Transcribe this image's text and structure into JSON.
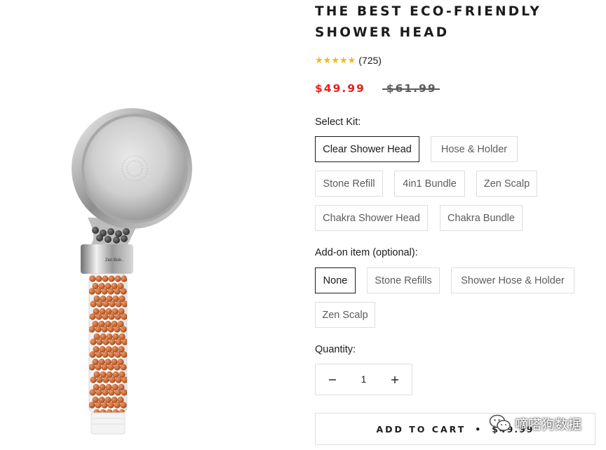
{
  "product": {
    "title_line1": "THE BEST ECO-FRIENDLY",
    "title_line2": "SHOWER HEAD",
    "rating_stars": 5,
    "rating_count": "(725)",
    "price_sale": "$49.99",
    "price_compare": "$61.99",
    "image_icon": "shower-head-photo"
  },
  "kit": {
    "label": "Select Kit:",
    "options": [
      "Clear Shower Head",
      "Hose & Holder",
      "Stone Refill",
      "4in1 Bundle",
      "Zen Scalp",
      "Chakra Shower Head",
      "Chakra Bundle"
    ],
    "selected": "Clear Shower Head"
  },
  "addon": {
    "label": "Add-on item (optional):",
    "options": [
      "None",
      "Stone Refills",
      "Shower Hose & Holder",
      "Zen Scalp"
    ],
    "selected": "None"
  },
  "quantity": {
    "label": "Quantity:",
    "value": "1",
    "decrement_icon": "minus-icon",
    "increment_icon": "plus-icon"
  },
  "cart": {
    "label": "ADD TO CART",
    "separator": "•",
    "price": "$49.99"
  },
  "watermark": {
    "text": "嘀嗒狗数据",
    "icon": "wechat-icon"
  },
  "colors": {
    "sale_price": "#e22120",
    "star": "#f5b90f",
    "text": "#1c1b1b",
    "border": "#dedede"
  }
}
